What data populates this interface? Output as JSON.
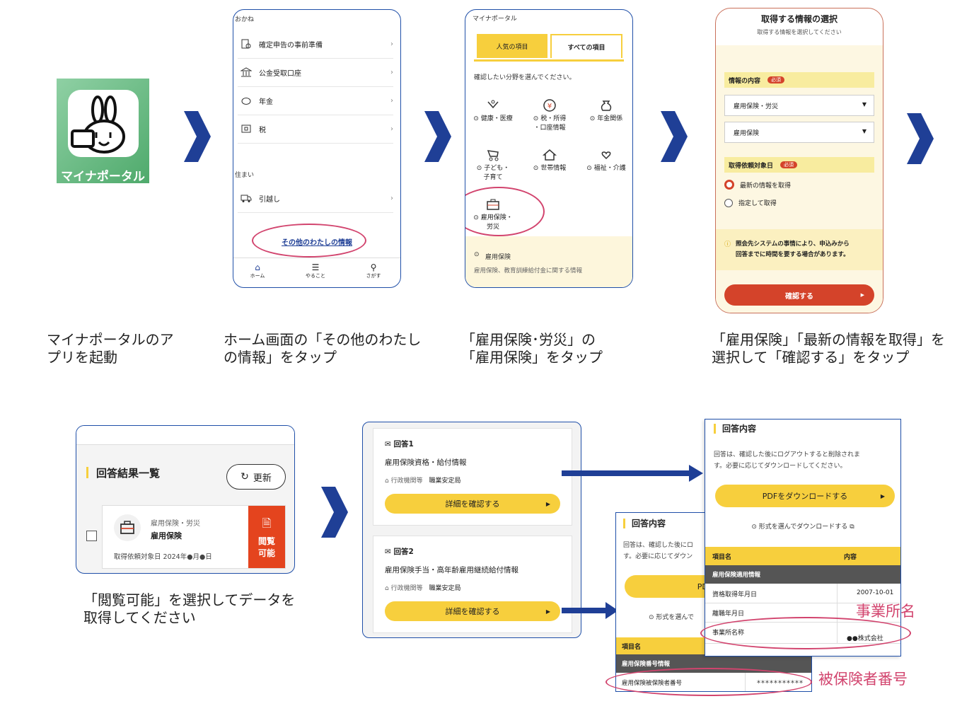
{
  "app_icon": {
    "label": "マイナポータル"
  },
  "captions": {
    "step1": [
      "マイナポータルのア",
      "プリを起動"
    ],
    "step2": [
      "ホーム画面の「その他のわたし",
      "の情報」をタップ"
    ],
    "step3": [
      "「雇用保険･労災」の",
      "「雇用保険」をタップ"
    ],
    "step4": [
      "「雇用保険」「最新の情報を取得」を",
      "選択して「確認する」をタップ"
    ],
    "step5": [
      "「閲覧可能」を選択してデータを",
      "取得してください"
    ]
  },
  "screen2": {
    "section_money": "おかね",
    "money_items": [
      "確定申告の事前準備",
      "公金受取口座",
      "年金",
      "税"
    ],
    "section_home": "住まい",
    "home_items": [
      "引越し"
    ],
    "other_info_link": "その他のわたしの情報",
    "nav": [
      "ホーム",
      "やること",
      "さがす"
    ],
    "arrow": "›"
  },
  "screen3": {
    "header": "マイナポータル",
    "tabs": [
      "人気の項目",
      "すべての項目"
    ],
    "instruction": "確認したい分野を選んでください。",
    "categories": [
      "健康・医療",
      "税・所得・口座情報",
      "年金関係",
      "子ども・子育て",
      "世帯情報",
      "福祉・介護",
      "雇用保険・労災"
    ],
    "cat_lines": {
      "c0": [
        "⊙ 健康・医療"
      ],
      "c1": [
        "⊙ 税・所得",
        "・口座情報"
      ],
      "c2": [
        "⊙ 年金関係"
      ],
      "c3": [
        "⊙ 子ども・",
        "子育て"
      ],
      "c4": [
        "⊙ 世帯情報"
      ],
      "c5": [
        "⊙ 福祉・介護"
      ],
      "c6": [
        "⊙ 雇用保険・",
        "労災"
      ]
    },
    "sub_item": "雇用保険",
    "sub_desc": "雇用保険、教育訓練給付金に関する情報"
  },
  "screen4": {
    "title": "取得する情報の選択",
    "subtitle": "取得する情報を選択してください",
    "info_label": "情報の内容",
    "required": "必須",
    "select1": "雇用保険・労災",
    "select2": "雇用保険",
    "date_label": "取得依頼対象日",
    "radio1": "最新の情報を取得",
    "radio2": "指定して取得",
    "notice": [
      "照会先システムの事情により、申込みから",
      "回答までに時間を要する場合があります。"
    ],
    "confirm_button": "確認する"
  },
  "screen5": {
    "title": "回答結果一覧",
    "refresh": "更新",
    "card_category": "雇用保険・労災",
    "card_title": "雇用保険",
    "card_date": "取得依頼対象日 2024年●月●日",
    "badge": [
      "閲覧",
      "可能"
    ]
  },
  "screen6": {
    "answers": [
      {
        "label": "回答1",
        "title": "雇用保険資格・給付情報",
        "agency_label": "行政機関等",
        "agency": "職業安定局",
        "button": "詳細を確認する"
      },
      {
        "label": "回答2",
        "title": "雇用保険手当・高年齢雇用継続給付情報",
        "agency_label": "行政機関等",
        "agency": "職業安定局",
        "button": "詳細を確認する"
      }
    ]
  },
  "screen7": {
    "title": "回答内容",
    "body": [
      "回答は、確認した後にログアウトすると削除されま",
      "す。必要に応じてダウンロードしてください。"
    ],
    "pdf_button": "PDFをダウンロードする",
    "format_link": "⊙ 形式を選んでダウンロードする",
    "col_item": "項目名",
    "col_content": "内容",
    "group": "雇用保険適用情報",
    "rows": [
      {
        "item": "資格取得年月日",
        "value": "2007-10-01"
      },
      {
        "item": "離職年月日",
        "value": ""
      },
      {
        "item": "事業所名称",
        "value": "●●株式会社"
      }
    ],
    "annotation": "事業所名"
  },
  "screen8": {
    "title": "回答内容",
    "body": [
      "回答は、確認した後にロ",
      "す。必要に応じてダウン"
    ],
    "pdf_button": "PDFをダウ",
    "format_link": "⊙ 形式を選んで",
    "col_item": "項目名",
    "group": "雇用保険番号情報",
    "row_item": "雇用保険被保険者番号",
    "row_value": "＊＊＊＊＊＊＊＊＊＊＊",
    "annotation": "被保険者番号"
  },
  "colors": {
    "navy": "#1f3f96",
    "yellow": "#f7cf3d",
    "red_ring": "#d2446e",
    "orange": "#d4432a",
    "annot": "#d2446e"
  }
}
